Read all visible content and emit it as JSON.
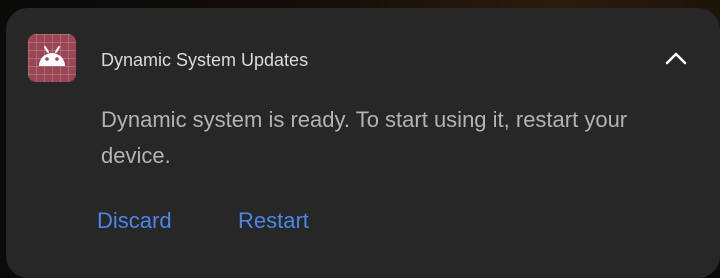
{
  "notification": {
    "app_name": "Dynamic System Updates",
    "message": "Dynamic system is ready. To start using it, restart your device.",
    "actions": {
      "discard_label": "Discard",
      "restart_label": "Restart"
    },
    "app_icon": "android-robot-icon",
    "collapse_icon": "chevron-up-icon",
    "colors": {
      "card_background": "#272727",
      "action_text": "#4a86e8",
      "app_icon_background": "#9a4655",
      "title_text": "#dadada",
      "message_text": "#b3b3b3"
    }
  }
}
